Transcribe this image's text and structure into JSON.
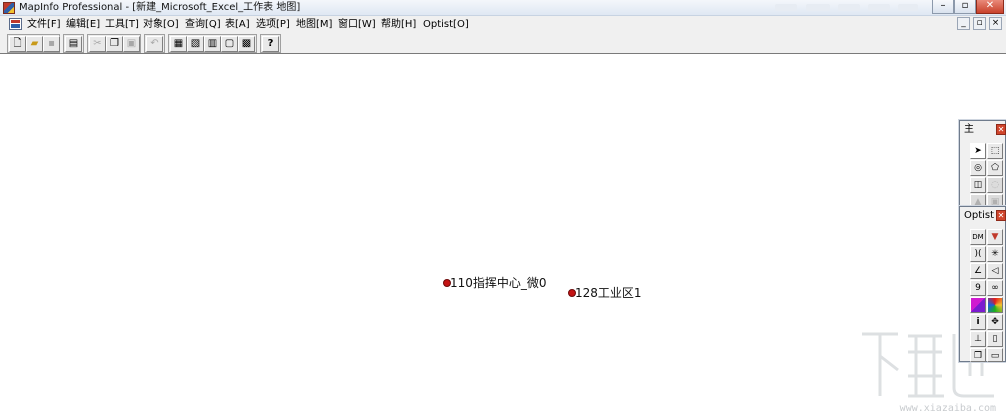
{
  "window": {
    "title": "MapInfo Professional - [新建_Microsoft_Excel_工作表 地图]"
  },
  "menu": {
    "items": [
      "文件[F]",
      "编辑[E]",
      "工具[T]",
      "对象[O]",
      "查询[Q]",
      "表[A]",
      "选项[P]",
      "地图[M]",
      "窗口[W]",
      "帮助[H]",
      "Optist[O]"
    ]
  },
  "toolbar": {
    "buttons": [
      "new-icon",
      "open-icon",
      "save-icon",
      "print-icon",
      "cut-icon",
      "copy-icon",
      "paste-icon",
      "undo-icon",
      "browser-icon",
      "map-icon",
      "graph-icon",
      "layout-icon",
      "redistrict-icon",
      "help-icon"
    ],
    "help_label": "?"
  },
  "map": {
    "points": [
      {
        "label": "110指挥中心_微0",
        "color": "#c41414"
      },
      {
        "label": "128工业区1",
        "color": "#c41414"
      }
    ]
  },
  "palettes": {
    "main": {
      "title": "主"
    },
    "optist": {
      "title": "Optist",
      "dm_label": "DM",
      "nine_label": "9",
      "info_label": "i"
    }
  },
  "watermark": {
    "text": "下载吧",
    "site": "www.xiazaiba.com"
  }
}
